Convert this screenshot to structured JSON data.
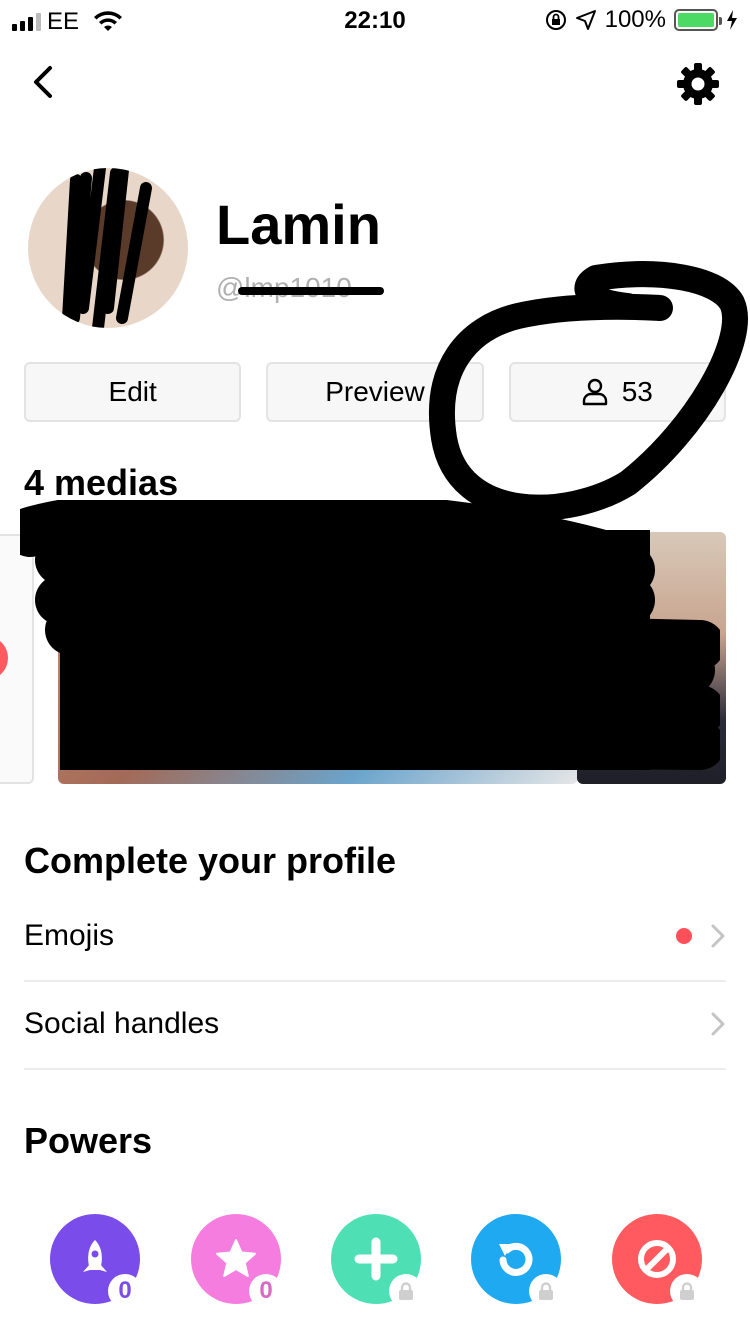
{
  "status_bar": {
    "carrier": "EE",
    "time": "22:10",
    "battery": "100%"
  },
  "profile": {
    "name": "Lamin",
    "handle": "@lmp1010"
  },
  "actions": {
    "edit_label": "Edit",
    "preview_label": "Preview",
    "followers_count": "53"
  },
  "medias": {
    "title": "4 medias"
  },
  "complete_profile": {
    "title": "Complete your profile",
    "items": [
      {
        "label": "Emojis",
        "has_alert": true
      },
      {
        "label": "Social handles",
        "has_alert": false
      }
    ]
  },
  "powers": {
    "title": "Powers",
    "items": [
      {
        "name": "rocket",
        "color": "#7a4dea",
        "badge": "0",
        "badge_color": "#7a4dea"
      },
      {
        "name": "star",
        "color": "#f67de0",
        "badge": "0",
        "badge_color": "#d86ac4"
      },
      {
        "name": "plus",
        "color": "#4ee0b4",
        "badge": "",
        "locked": true
      },
      {
        "name": "refresh",
        "color": "#1fa9f0",
        "badge": "",
        "locked": true
      },
      {
        "name": "block",
        "color": "#ff5a5f",
        "badge": "",
        "locked": true
      }
    ]
  }
}
